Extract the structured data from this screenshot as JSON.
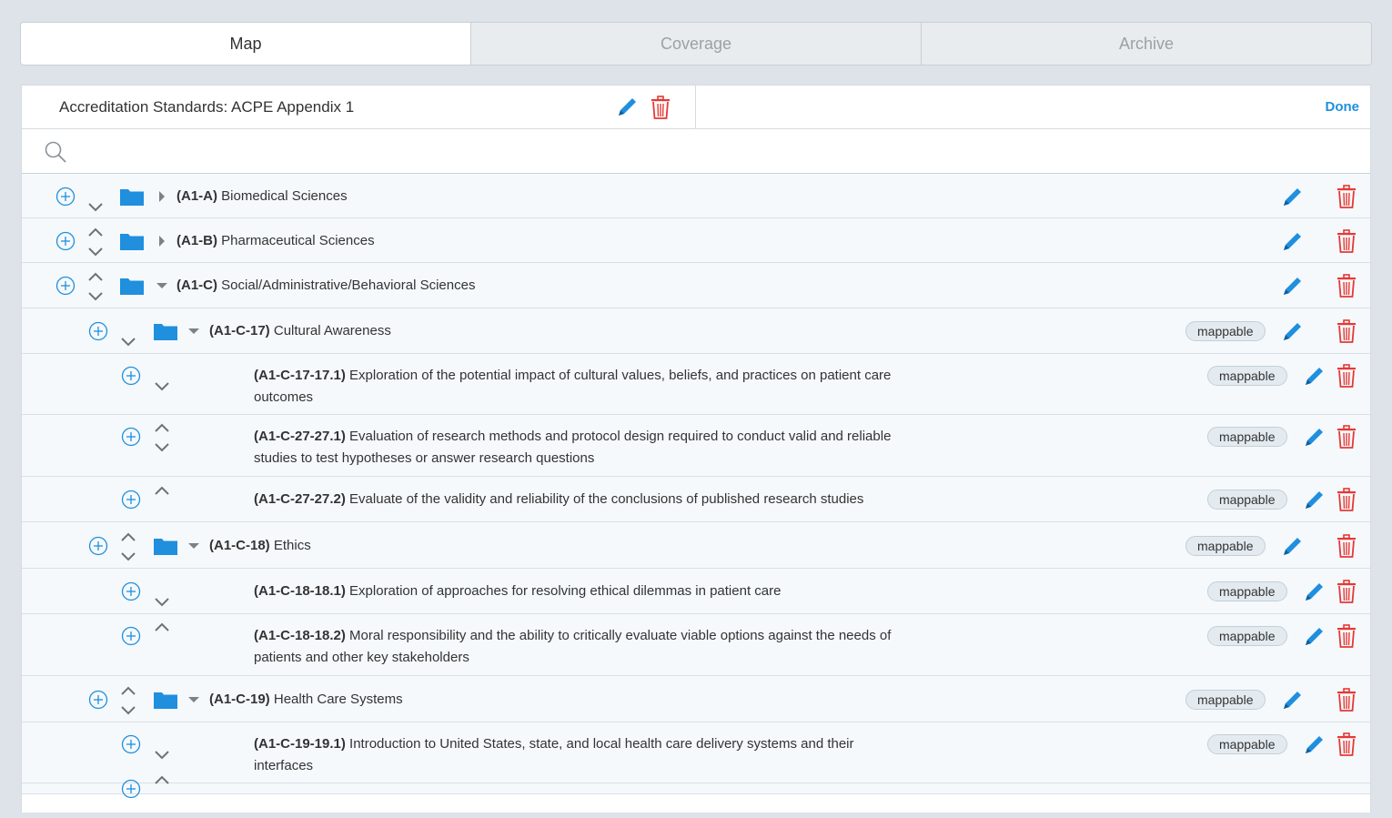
{
  "tabs": [
    {
      "label": "Map",
      "active": true
    },
    {
      "label": "Coverage",
      "active": false
    },
    {
      "label": "Archive",
      "active": false
    }
  ],
  "header": {
    "title": "Accreditation Standards: ACPE Appendix 1",
    "done_label": "Done"
  },
  "search": {
    "placeholder": "",
    "value": ""
  },
  "badge_label": "mappable",
  "colors": {
    "accent": "#1f8fde",
    "folder": "#1f8fde",
    "delete": "#e53935",
    "row_bg": "#f5f9fc"
  },
  "rows": [
    {
      "code": "(A1-A)",
      "text": "Biomedical Sciences",
      "level": 0,
      "type": "folder",
      "expanded": false,
      "up": false,
      "down": true,
      "mappable": false
    },
    {
      "code": "(A1-B)",
      "text": "Pharmaceutical Sciences",
      "level": 0,
      "type": "folder",
      "expanded": false,
      "up": true,
      "down": true,
      "mappable": false
    },
    {
      "code": "(A1-C)",
      "text": "Social/Administrative/Behavioral Sciences",
      "level": 0,
      "type": "folder",
      "expanded": true,
      "up": true,
      "down": true,
      "mappable": false
    },
    {
      "code": "(A1-C-17)",
      "text": "Cultural Awareness",
      "level": 1,
      "type": "folder",
      "expanded": true,
      "up": false,
      "down": true,
      "mappable": true
    },
    {
      "code": "(A1-C-17-17.1)",
      "text": "Exploration of the potential impact of cultural values, beliefs, and practices on patient care",
      "text2": "outcomes",
      "level": 2,
      "type": "item",
      "up": false,
      "down": true,
      "mappable": true
    },
    {
      "code": "(A1-C-27-27.1)",
      "text": "Evaluation of research methods and protocol design required to conduct valid and reliable",
      "text2": "studies to test hypotheses or answer research questions",
      "level": 2,
      "type": "item",
      "up": true,
      "down": true,
      "mappable": true
    },
    {
      "code": "(A1-C-27-27.2)",
      "text": "Evaluate of the validity and reliability of the conclusions of published research studies",
      "level": 2,
      "type": "item",
      "up": true,
      "down": false,
      "mappable": true
    },
    {
      "code": "(A1-C-18)",
      "text": "Ethics",
      "level": 1,
      "type": "folder",
      "expanded": true,
      "up": true,
      "down": true,
      "mappable": true
    },
    {
      "code": "(A1-C-18-18.1)",
      "text": "Exploration of approaches for resolving ethical dilemmas in patient care",
      "level": 2,
      "type": "item",
      "up": false,
      "down": true,
      "mappable": true
    },
    {
      "code": "(A1-C-18-18.2)",
      "text": "Moral responsibility and the ability to critically evaluate viable options against the needs of",
      "text2": "patients and other key stakeholders",
      "level": 2,
      "type": "item",
      "up": true,
      "down": false,
      "mappable": true
    },
    {
      "code": "(A1-C-19)",
      "text": "Health Care Systems",
      "level": 1,
      "type": "folder",
      "expanded": true,
      "up": true,
      "down": true,
      "mappable": true
    },
    {
      "code": "(A1-C-19-19.1)",
      "text": "Introduction to United States, state, and local health care delivery systems and their",
      "text2": "interfaces",
      "level": 2,
      "type": "item",
      "up": false,
      "down": true,
      "mappable": true
    },
    {
      "code": "",
      "text": "",
      "level": 2,
      "type": "item",
      "up": true,
      "down": false,
      "mappable": false,
      "partial": true
    }
  ]
}
